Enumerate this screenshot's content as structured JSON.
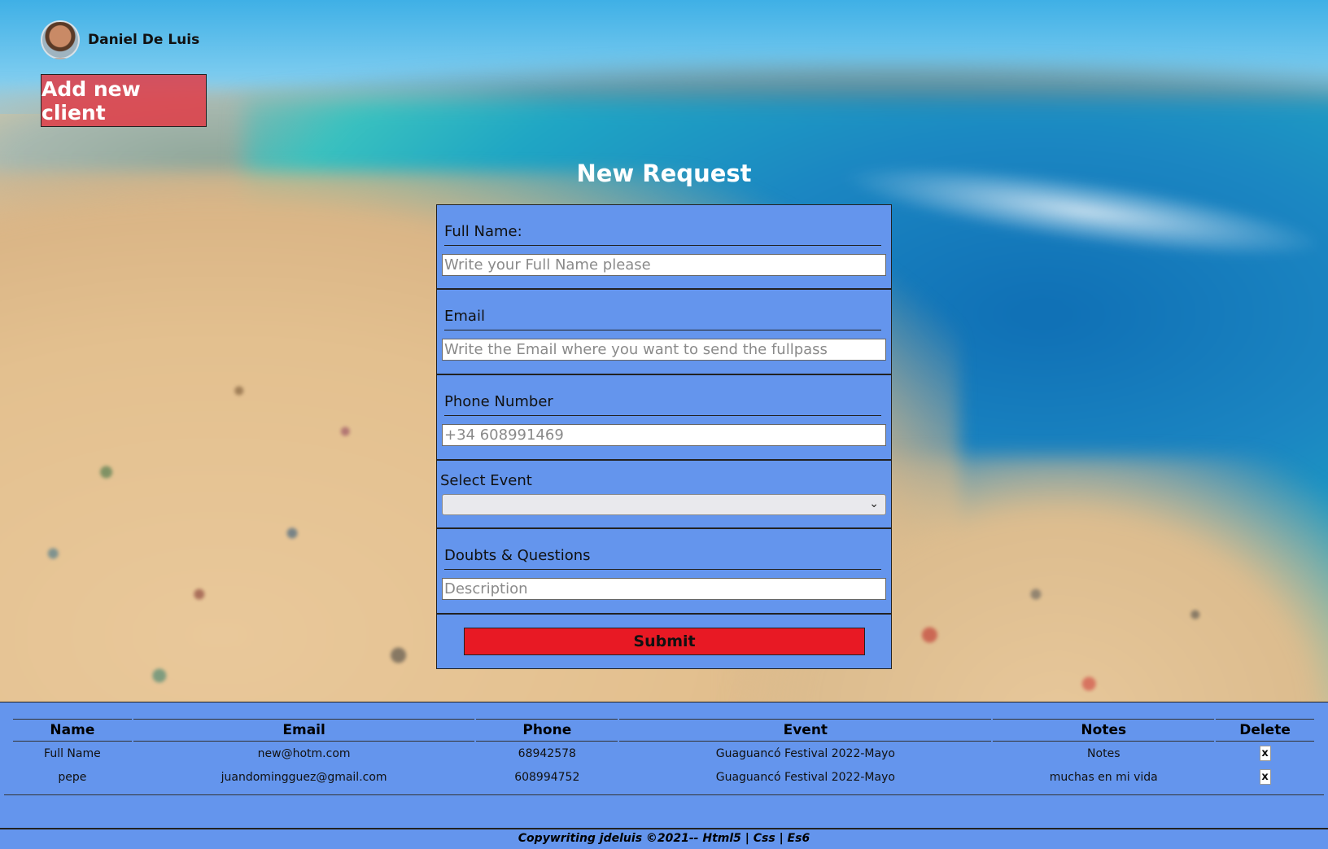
{
  "user": {
    "name": "Daniel De Luis"
  },
  "actions": {
    "add_client_label": "Add new client"
  },
  "form": {
    "title": "New Request",
    "full_name": {
      "label": "Full Name:",
      "placeholder": "Write your Full Name please"
    },
    "email": {
      "label": "Email",
      "placeholder": "Write the Email where you want to send the fullpass"
    },
    "phone": {
      "label": "Phone Number",
      "placeholder": "+34 608991469"
    },
    "event": {
      "label": "Select Event",
      "selected": ""
    },
    "doubts": {
      "label": "Doubts & Questions",
      "placeholder": "Description"
    },
    "submit_label": "Submit"
  },
  "table": {
    "headers": [
      "Name",
      "Email",
      "Phone",
      "Event",
      "Notes",
      "Delete"
    ],
    "rows": [
      {
        "name": "Full Name",
        "email": "new@hotm.com",
        "phone": "68942578",
        "event": "Guaguancó Festival 2022-Mayo",
        "notes": "Notes",
        "delete": "x"
      },
      {
        "name": "pepe",
        "email": "juandomingguez@gmail.com",
        "phone": "608994752",
        "event": "Guaguancó Festival 2022-Mayo",
        "notes": "muchas en mi vida",
        "delete": "x"
      }
    ]
  },
  "footer": {
    "text": "Copywriting jdeluis ©2021-- Html5 | Css | Es6"
  },
  "icons": {
    "avatar": "user-avatar",
    "select_chevron": "chevron-down-icon"
  },
  "colors": {
    "panel": "#6495ed",
    "submit": "#e81924",
    "add_client": "#e03c46"
  }
}
